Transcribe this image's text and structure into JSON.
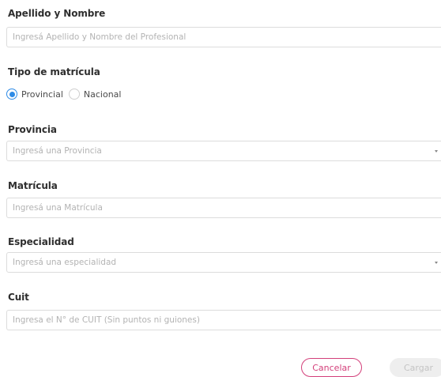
{
  "form": {
    "name": {
      "label": "Apellido y Nombre",
      "placeholder": "Ingresá Apellido y Nombre del Profesional",
      "value": ""
    },
    "tipo": {
      "label": "Tipo de matrícula",
      "options": [
        {
          "label": "Provincial",
          "selected": true
        },
        {
          "label": "Nacional",
          "selected": false
        }
      ]
    },
    "provincia": {
      "label": "Provincia",
      "placeholder": "Ingresá una Provincia",
      "value": ""
    },
    "matricula": {
      "label": "Matrícula",
      "placeholder": "Ingresá una Matrícula",
      "value": ""
    },
    "especialidad": {
      "label": "Especialidad",
      "placeholder": "Ingresá una especialidad",
      "value": ""
    },
    "cuit": {
      "label": "Cuit",
      "placeholder": "Ingresa el N° de CUIT (Sin puntos ni guiones)",
      "value": ""
    }
  },
  "actions": {
    "cancel_label": "Cancelar",
    "submit_label": "Cargar"
  },
  "colors": {
    "accent": "#d33f7a",
    "radio": "#2e8be6"
  }
}
